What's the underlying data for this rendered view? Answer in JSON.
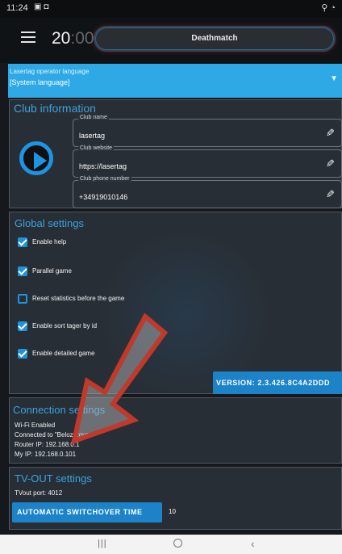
{
  "status_bar": {
    "time": "11:24"
  },
  "topbar": {
    "timer_main": "20",
    "timer_dim": ":00",
    "mode_label": "Deathmatch"
  },
  "language": {
    "label": "Lasertag operator language",
    "value": "[System language]"
  },
  "club": {
    "title": "Club information",
    "fields": [
      {
        "label": "Club name",
        "value": "lasertag"
      },
      {
        "label": "Club website",
        "value": "https://lasertag"
      },
      {
        "label": "Club phone number",
        "value": "+34919010146"
      }
    ]
  },
  "global": {
    "title": "Global settings",
    "checkboxes": [
      {
        "label": "Enable help",
        "checked": true
      },
      {
        "label": "Parallel game",
        "checked": true
      },
      {
        "label": "Reset statistics before the game",
        "checked": false
      },
      {
        "label": "Enable sort tager by id",
        "checked": true
      },
      {
        "label": "Enable detailed game ",
        "checked": true
      }
    ],
    "version_label": "VERSION: 2.3.426.8C4A2DDD"
  },
  "connection": {
    "title": "Connection settings",
    "lines": [
      "Wi-Fi Enabled",
      "Connected to \"Belozerova",
      "Router IP: 192.168.0.1",
      "My IP: 192.168.0.101"
    ]
  },
  "tvout": {
    "title": "TV-OUT settings",
    "port_line": "TVout port: 4012",
    "button_label": "AUTOMATIC SWITCHOVER TIME",
    "button_value": "10"
  },
  "colors": {
    "accent": "#2ea9e6",
    "button": "#1c83c8",
    "panel": "#2c333a",
    "arrow": "#c0392b"
  }
}
